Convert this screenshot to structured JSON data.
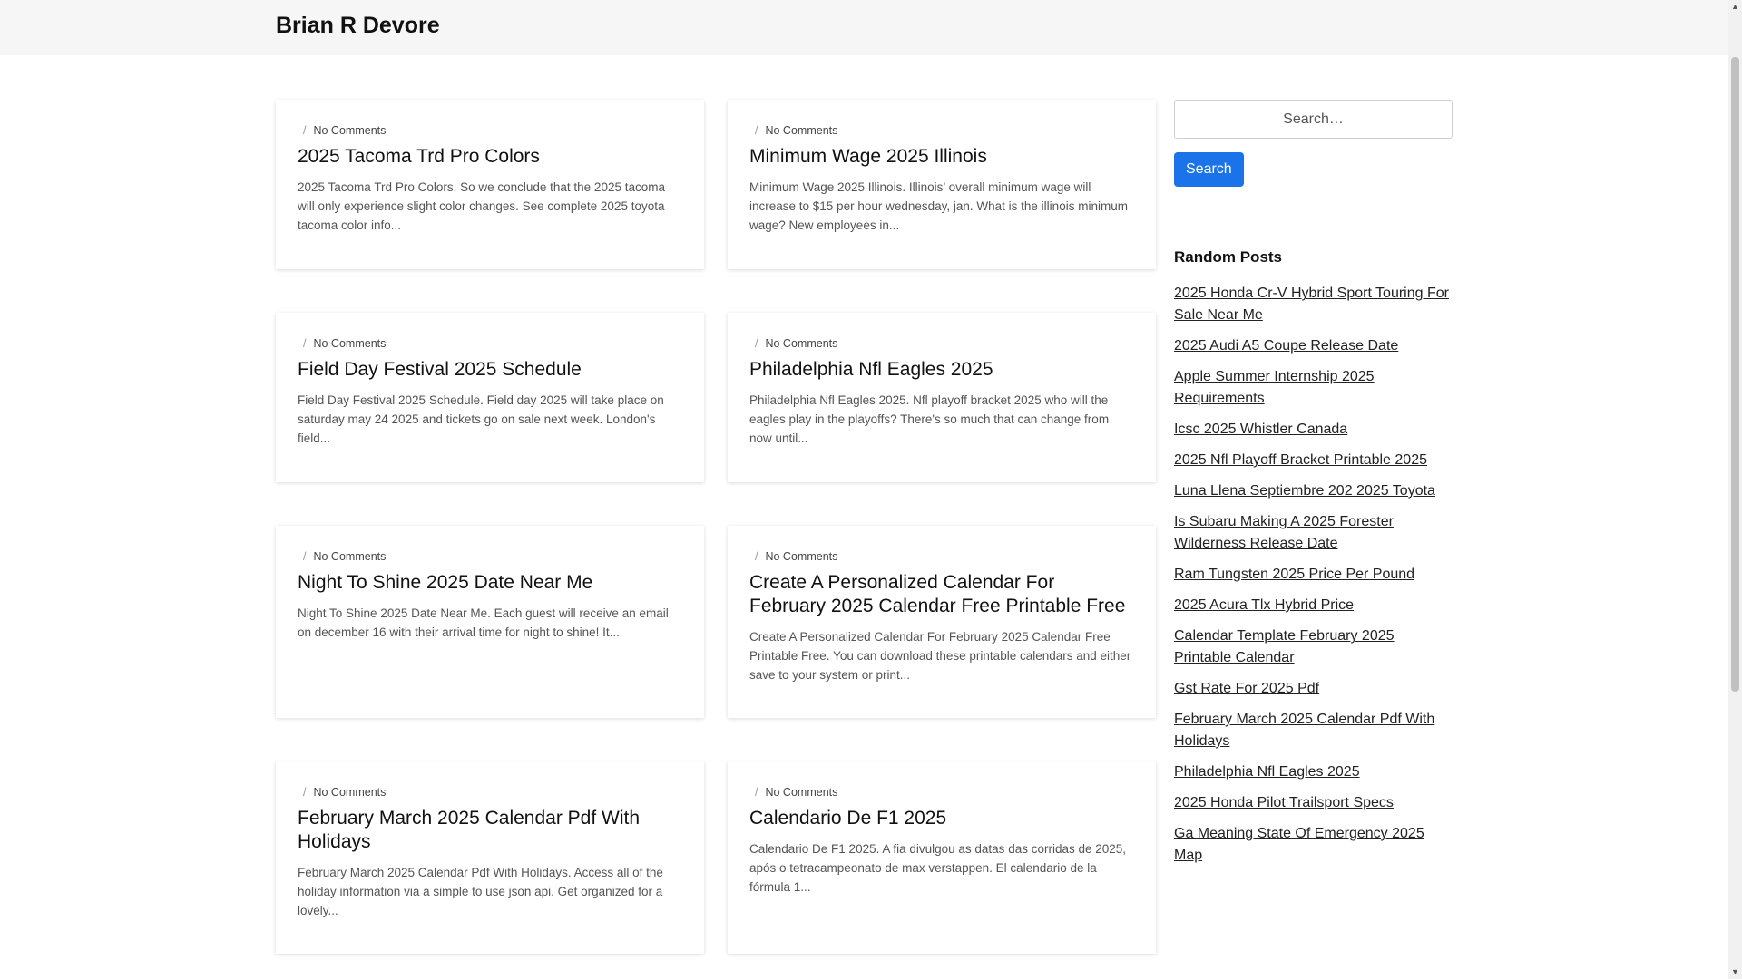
{
  "header": {
    "site_title": "Brian R Devore"
  },
  "posts": [
    {
      "meta": "No Comments",
      "title": "2025 Tacoma Trd Pro Colors",
      "excerpt": "2025 Tacoma Trd Pro Colors. So we conclude that the 2025 tacoma will only experience slight color changes. See complete 2025 toyota tacoma color info..."
    },
    {
      "meta": "No Comments",
      "title": "Minimum Wage 2025 Illinois",
      "excerpt": "Minimum Wage 2025 Illinois. Illinois’ overall minimum wage will increase to $15 per hour wednesday, jan. What is the illinois minimum wage? New employees in..."
    },
    {
      "meta": "No Comments",
      "title": "Field Day Festival 2025 Schedule",
      "excerpt": "Field Day Festival 2025 Schedule. Field day 2025 will take place on saturday may 24 2025 and tickets go on sale next week. London's field..."
    },
    {
      "meta": "No Comments",
      "title": "Philadelphia Nfl Eagles 2025",
      "excerpt": "Philadelphia Nfl Eagles 2025. Nfl playoff bracket 2025 who will the eagles play in the playoffs? There's so much that can change from now until..."
    },
    {
      "meta": "No Comments",
      "title": "Night To Shine 2025 Date Near Me",
      "excerpt": "Night To Shine 2025 Date Near Me. Each guest will receive an email on december 16 with their arrival time for night to shine! It..."
    },
    {
      "meta": "No Comments",
      "title": "Create A Personalized Calendar For February 2025 Calendar Free Printable Free",
      "excerpt": "Create A Personalized Calendar For February 2025 Calendar Free Printable Free. You can download these printable calendars and either save to your system or print..."
    },
    {
      "meta": "No Comments",
      "title": "February March 2025 Calendar Pdf With Holidays",
      "excerpt": "February March 2025 Calendar Pdf With Holidays. Access all of the holiday information via a simple to use json api. Get organized for a lovely..."
    },
    {
      "meta": "No Comments",
      "title": "Calendario De F1 2025",
      "excerpt": "Calendario De F1 2025. A fia divulgou as datas das corridas de 2025, após o tetracampeonato de max verstappen. El calendario de la fórmula 1..."
    }
  ],
  "search": {
    "placeholder": "Search…",
    "button_label": "Search"
  },
  "sidebar": {
    "widget_title": "Random Posts",
    "links": [
      "2025 Honda Cr-V Hybrid Sport Touring For Sale Near Me",
      "2025 Audi A5 Coupe Release Date",
      "Apple Summer Internship 2025 Requirements",
      "Icsc 2025 Whistler Canada",
      "2025 Nfl Playoff Bracket Printable 2025",
      "Luna Llena Septiembre 202 2025 Toyota",
      "Is Subaru Making A 2025 Forester Wilderness Release Date",
      "Ram Tungsten 2025 Price Per Pound",
      "2025 Acura Tlx Hybrid Price",
      "Calendar Template February 2025 Printable Calendar",
      "Gst Rate For 2025 Pdf",
      "February March 2025 Calendar Pdf With Holidays",
      "Philadelphia Nfl Eagles 2025",
      "2025 Honda Pilot Trailsport Specs",
      "Ga Meaning State Of Emergency 2025 Map"
    ]
  },
  "colors": {
    "accent": "#1a73e8",
    "header_bg": "#f6f6f6"
  }
}
